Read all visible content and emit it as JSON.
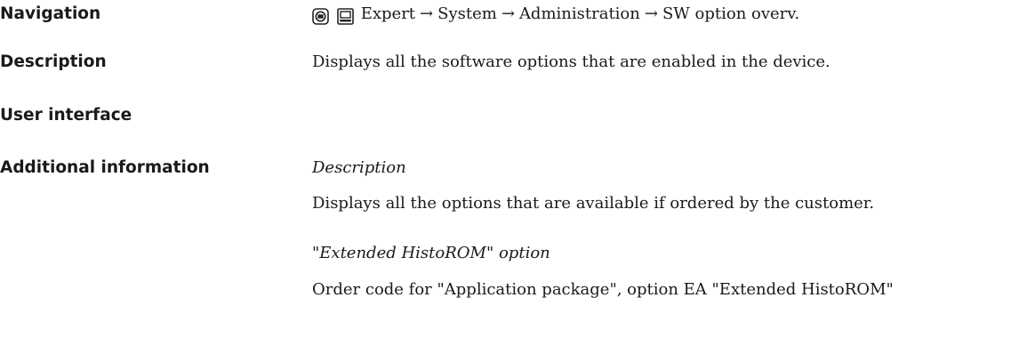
{
  "navigation": {
    "label": "Navigation",
    "icons": [
      "local-display-icon",
      "operating-tool-icon"
    ],
    "path": [
      "Expert",
      "System",
      "Administration",
      "SW option overv."
    ],
    "separator": "→"
  },
  "description": {
    "label": "Description",
    "text": "Displays all the software options that are enabled in the device."
  },
  "user_interface": {
    "label": "User interface"
  },
  "additional_information": {
    "label": "Additional information",
    "subheading_1": "Description",
    "text_1": "Displays all the options that are available if ordered by the customer.",
    "subheading_2": "\"Extended HistoROM\" option",
    "text_2": "Order code for \"Application package\", option EA \"Extended HistoROM\""
  }
}
